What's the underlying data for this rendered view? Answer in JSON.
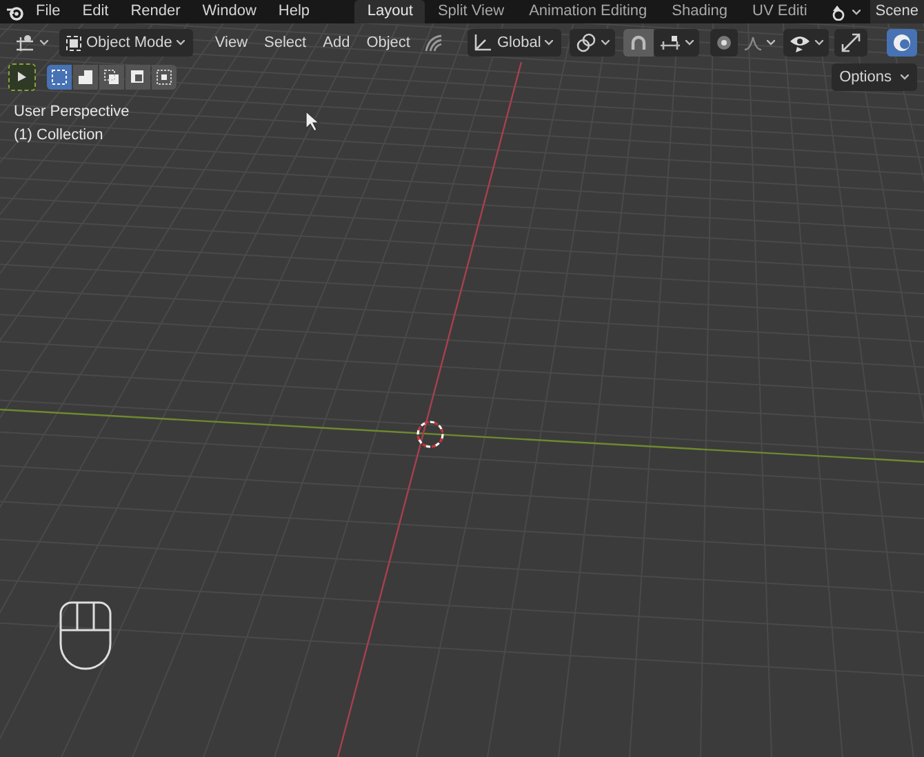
{
  "menu": [
    {
      "label": "File"
    },
    {
      "label": "Edit"
    },
    {
      "label": "Render"
    },
    {
      "label": "Window"
    },
    {
      "label": "Help"
    }
  ],
  "workspace_tabs": [
    {
      "label": "Layout",
      "selected": true
    },
    {
      "label": "Split View",
      "selected": false
    },
    {
      "label": "Animation Editing",
      "selected": false
    },
    {
      "label": "Shading",
      "selected": false
    },
    {
      "label": "UV Editi",
      "selected": false
    }
  ],
  "scene": "Scene",
  "header": {
    "mode": "Object Mode",
    "menus": [
      "View",
      "Select",
      "Add",
      "Object"
    ],
    "orientation": "Global",
    "snap_on": true,
    "overlay_on": true
  },
  "tool_settings": {
    "select_modes": [
      {
        "selected": true
      },
      {
        "selected": false
      },
      {
        "selected": false
      },
      {
        "selected": false
      },
      {
        "selected": false
      }
    ],
    "options": "Options"
  },
  "viewport_info": [
    "User Perspective",
    "(1) Collection"
  ]
}
